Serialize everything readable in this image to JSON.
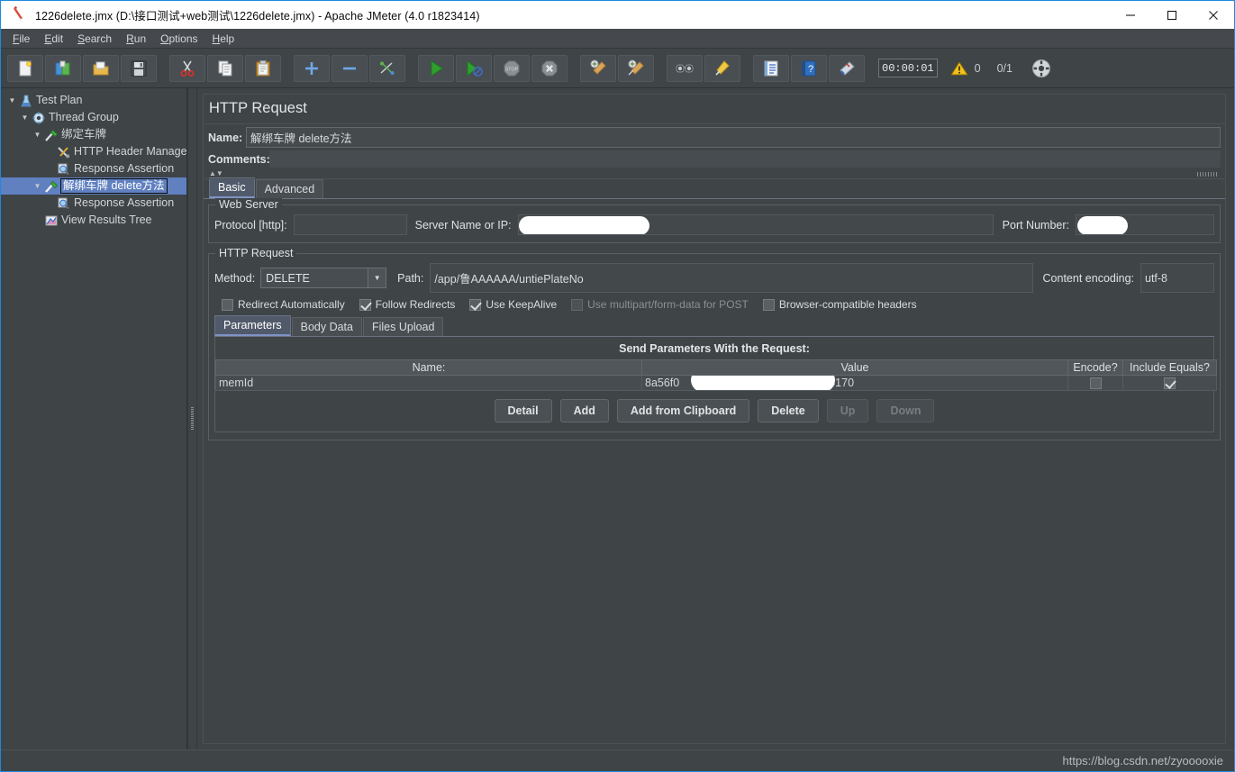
{
  "window": {
    "title": "1226delete.jmx (D:\\接口测试+web测试\\1226delete.jmx) - Apache JMeter (4.0 r1823414)",
    "app_icon": "jmeter-feather-icon",
    "minimize": "—",
    "maximize": "□",
    "close": "✕"
  },
  "menubar": {
    "items": [
      {
        "label": "File",
        "mnemonic": "F"
      },
      {
        "label": "Edit",
        "mnemonic": "E"
      },
      {
        "label": "Search",
        "mnemonic": "S"
      },
      {
        "label": "Run",
        "mnemonic": "R"
      },
      {
        "label": "Options",
        "mnemonic": "O"
      },
      {
        "label": "Help",
        "mnemonic": "H"
      }
    ]
  },
  "toolbar": {
    "buttons": [
      {
        "name": "new-icon",
        "title": "New"
      },
      {
        "name": "templates-icon",
        "title": "Templates"
      },
      {
        "name": "open-icon",
        "title": "Open"
      },
      {
        "name": "save-icon",
        "title": "Save"
      },
      {
        "name": "cut-icon",
        "title": "Cut"
      },
      {
        "name": "copy-icon",
        "title": "Copy"
      },
      {
        "name": "paste-icon",
        "title": "Paste"
      },
      {
        "name": "expand-all-icon",
        "title": "Expand All"
      },
      {
        "name": "collapse-all-icon",
        "title": "Collapse All"
      },
      {
        "name": "toggle-icon",
        "title": "Toggle"
      },
      {
        "name": "start-icon",
        "title": "Start"
      },
      {
        "name": "start-no-pauses-icon",
        "title": "Start no pauses"
      },
      {
        "name": "stop-icon",
        "title": "Stop"
      },
      {
        "name": "shutdown-icon",
        "title": "Shutdown"
      },
      {
        "name": "clear-icon",
        "title": "Clear"
      },
      {
        "name": "clear-all-icon",
        "title": "Clear All"
      },
      {
        "name": "search-icon",
        "title": "Search"
      },
      {
        "name": "search-reset-icon",
        "title": "Reset Search"
      },
      {
        "name": "function-helper-icon",
        "title": "Function Helper Dialog"
      },
      {
        "name": "help-icon",
        "title": "Help"
      },
      {
        "name": "undo-icon",
        "title": "Undo"
      }
    ],
    "timer": "00:00:01",
    "warning_count": "0",
    "thread_count": "0/1",
    "gear_icon": "remote-icon"
  },
  "tree": {
    "nodes": [
      {
        "label": "Test Plan",
        "icon": "test-plan-icon",
        "indent": 0,
        "twisty": "▼",
        "selected": false
      },
      {
        "label": "Thread Group",
        "icon": "thread-group-icon",
        "indent": 1,
        "twisty": "▼",
        "selected": false
      },
      {
        "label": "绑定车牌",
        "icon": "http-request-icon",
        "indent": 2,
        "twisty": "▼",
        "selected": false
      },
      {
        "label": "HTTP Header Manager",
        "icon": "header-manager-icon",
        "indent": 3,
        "twisty": "",
        "selected": false
      },
      {
        "label": "Response Assertion",
        "icon": "assertion-icon",
        "indent": 3,
        "twisty": "",
        "selected": false
      },
      {
        "label": "解绑车牌 delete方法",
        "icon": "http-request-icon",
        "indent": 2,
        "twisty": "▼",
        "selected": true
      },
      {
        "label": "Response Assertion",
        "icon": "assertion-icon",
        "indent": 3,
        "twisty": "",
        "selected": false
      },
      {
        "label": "View Results Tree",
        "icon": "view-results-tree-icon",
        "indent": 2,
        "twisty": "",
        "selected": false
      }
    ]
  },
  "main": {
    "panel_title": "HTTP Request",
    "name_label": "Name:",
    "name_value": "解绑车牌 delete方法",
    "comments_label": "Comments:",
    "comments_value": "",
    "tabs": [
      {
        "label": "Basic",
        "active": true
      },
      {
        "label": "Advanced",
        "active": false
      }
    ],
    "web_server": {
      "legend": "Web Server",
      "protocol_label": "Protocol [http]:",
      "protocol_value": "",
      "server_label": "Server Name or IP:",
      "server_value": "",
      "server_redacted": true,
      "port_label": "Port Number:",
      "port_value": "",
      "port_redacted": true
    },
    "http_request": {
      "legend": "HTTP Request",
      "method_label": "Method:",
      "method_value": "DELETE",
      "path_label": "Path:",
      "path_value": "/app/鲁AAAAAA/untiePlateNo",
      "encoding_label": "Content encoding:",
      "encoding_value": "utf-8",
      "checkboxes": [
        {
          "label": "Redirect Automatically",
          "checked": false,
          "enabled": true
        },
        {
          "label": "Follow Redirects",
          "checked": true,
          "enabled": true
        },
        {
          "label": "Use KeepAlive",
          "checked": true,
          "enabled": true
        },
        {
          "label": "Use multipart/form-data for POST",
          "checked": false,
          "enabled": false
        },
        {
          "label": "Browser-compatible headers",
          "checked": false,
          "enabled": true
        }
      ]
    },
    "param_tabs": [
      {
        "label": "Parameters",
        "active": true
      },
      {
        "label": "Body Data",
        "active": false
      },
      {
        "label": "Files Upload",
        "active": false
      }
    ],
    "params_table": {
      "caption": "Send Parameters With the Request:",
      "columns": [
        "Name:",
        "Value",
        "Encode?",
        "Include Equals?"
      ],
      "rows": [
        {
          "name": "memId",
          "value_prefix": "8a56f0",
          "value_suffix": "4170",
          "value_redacted": true,
          "encode": false,
          "include_equals": true
        }
      ]
    },
    "buttons": [
      {
        "label": "Detail",
        "enabled": true
      },
      {
        "label": "Add",
        "enabled": true
      },
      {
        "label": "Add from Clipboard",
        "enabled": true
      },
      {
        "label": "Delete",
        "enabled": true
      },
      {
        "label": "Up",
        "enabled": false
      },
      {
        "label": "Down",
        "enabled": false
      }
    ]
  },
  "statusbar": {
    "watermark": "https://blog.csdn.net/zyooooxie"
  },
  "colors": {
    "window_border": "#1b8ae0",
    "panel_bg": "#3f4447",
    "selection": "#6080c0",
    "text": "#dfe2e4",
    "redaction": "#ffffff"
  }
}
